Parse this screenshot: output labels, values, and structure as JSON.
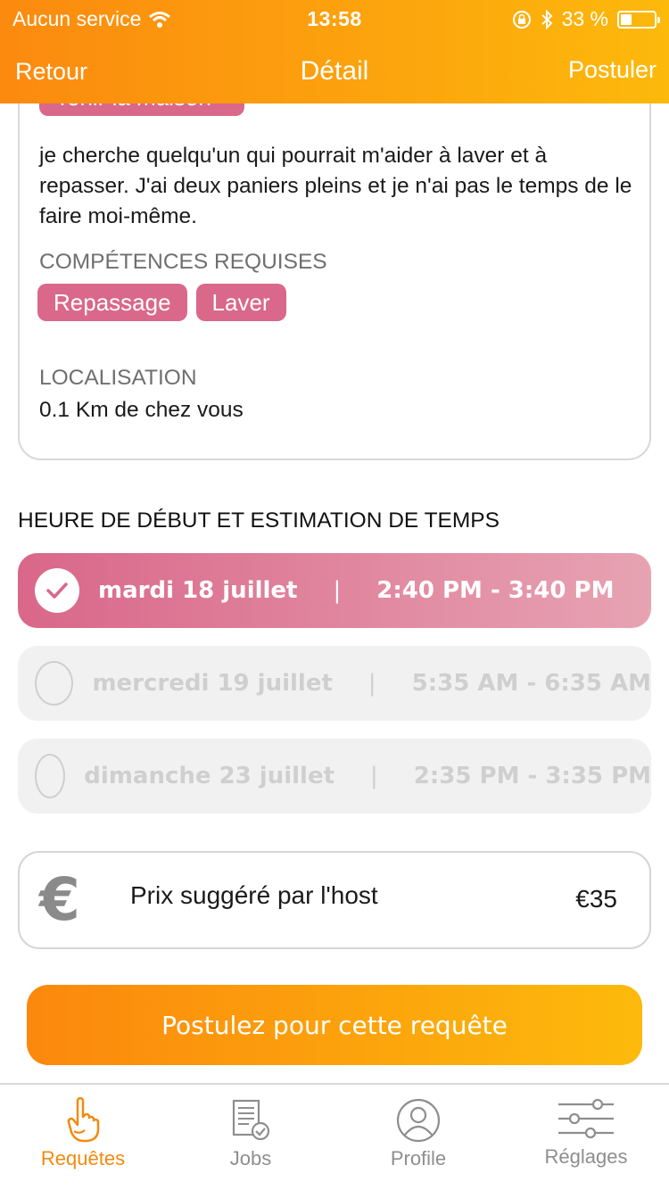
{
  "status_bar": {
    "carrier": "Aucun service",
    "time": "13:58",
    "battery_percent": "33 %",
    "battery_level": 0.33
  },
  "nav": {
    "back": "Retour",
    "title": "Détail",
    "action": "Postuler"
  },
  "details": {
    "category_tag": "Tenir la maison",
    "description": "je cherche quelqu'un qui pourrait m'aider à laver et à repasser. J'ai deux paniers pleins et je n'ai pas le temps de le faire moi-même.",
    "skills_label": "COMPÉTENCES REQUISES",
    "skills": [
      "Repassage",
      "Laver"
    ],
    "location_label": "LOCALISATION",
    "location_value": "0.1 Km de chez vous"
  },
  "schedule": {
    "title": "HEURE DE DÉBUT ET ESTIMATION DE TEMPS",
    "separator": "|",
    "slots": [
      {
        "day": "mardi 18 juillet",
        "time": "2:40 PM - 3:40 PM",
        "selected": true
      },
      {
        "day": "mercredi 19 juillet",
        "time": "5:35 AM - 6:35 AM",
        "selected": false
      },
      {
        "day": "dimanche 23 juillet",
        "time": "2:35 PM - 3:35 PM",
        "selected": false
      }
    ]
  },
  "price": {
    "symbol": "€",
    "label": "Prix suggéré par l'host",
    "value": "€35"
  },
  "cta": {
    "label": "Postulez pour cette requête"
  },
  "tabbar": {
    "items": [
      {
        "label": "Requêtes",
        "icon": "hand-pointer-icon",
        "active": true
      },
      {
        "label": "Jobs",
        "icon": "document-check-icon",
        "active": false
      },
      {
        "label": "Profile",
        "icon": "user-circle-icon",
        "active": false
      },
      {
        "label": "Réglages",
        "icon": "sliders-icon",
        "active": false
      }
    ]
  },
  "colors": {
    "accent_orange": "#fb8a0f",
    "accent_yellow": "#fdb90c",
    "tag_pink": "#d9688a"
  }
}
